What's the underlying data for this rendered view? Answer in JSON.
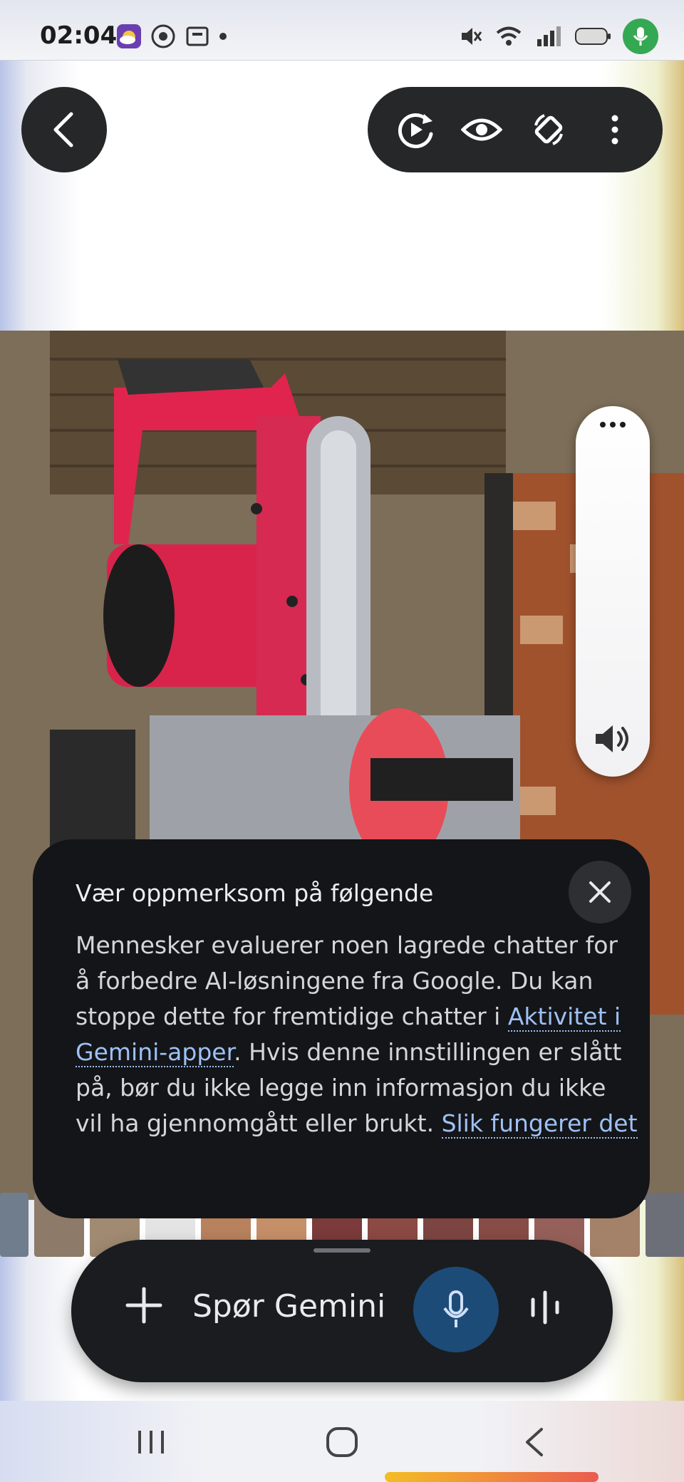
{
  "status_bar": {
    "time": "02:04",
    "icons": [
      "cloud-weather-icon",
      "chrome-icon",
      "fire-app-icon",
      "more-dot-icon"
    ],
    "right_icons": [
      "mute-icon",
      "wifi-icon",
      "signal-6g-icon",
      "battery-icon",
      "mic-active-icon"
    ]
  },
  "toolbar": {
    "back": "back-arrow-icon",
    "actions": [
      "play-rotate-icon",
      "eye-icon",
      "rotate-icon",
      "more-vert-icon"
    ]
  },
  "volume_panel": {
    "icons": [
      "more-horiz-icon",
      "speaker-icon"
    ],
    "level": 0
  },
  "notice": {
    "title": "Vær oppmerksom på følgende",
    "body_part1": "Mennesker evaluerer noen lagrede chatter for å forbedre AI-løsningene fra Google. Du kan stoppe dette for fremtidige chatter i ",
    "link1": "Aktivitet i Gemini-apper",
    "body_part2": ". Hvis denne innstillingen er slått på, bør du ikke legge inn informasjon du ikke vil ha gjennomgått eller brukt. ",
    "link2": "Slik fungerer det"
  },
  "gemini_bar": {
    "placeholder": "Spør Gemini"
  },
  "colors": {
    "card_bg": "#141518",
    "link": "#9ec1f5",
    "mic_button": "#1d4b78",
    "saw_red": "#e0244e",
    "status_mic": "#34a853"
  }
}
